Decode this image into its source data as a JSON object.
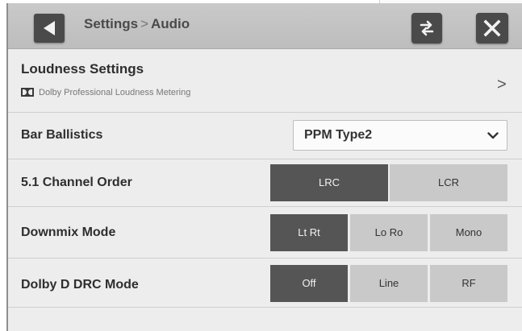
{
  "header": {
    "breadcrumb_parent": "Settings",
    "breadcrumb_separator": ">",
    "breadcrumb_current": "Audio",
    "icons": {
      "back": "back-arrow-icon",
      "swap": "swap-arrows-icon",
      "close": "close-x-icon"
    }
  },
  "loudness": {
    "title": "Loudness Settings",
    "subtitle": "Dolby Professional Loudness Metering",
    "chevron": ">"
  },
  "bar_ballistics": {
    "label": "Bar Ballistics",
    "value": "PPM Type2"
  },
  "channel_order": {
    "label": "5.1 Channel Order",
    "options": [
      "LRC",
      "LCR"
    ],
    "selected": "LRC"
  },
  "downmix": {
    "label": "Downmix Mode",
    "options": [
      "Lt Rt",
      "Lo Ro",
      "Mono"
    ],
    "selected": "Lt Rt"
  },
  "drc": {
    "label": "Dolby D DRC Mode",
    "options": [
      "Off",
      "Line",
      "RF"
    ],
    "selected": "Off"
  },
  "colors": {
    "selected_segment": "#555555",
    "unselected_segment": "#c9c9c9",
    "panel": "#ededed",
    "topbar": "#c4c4c4"
  }
}
